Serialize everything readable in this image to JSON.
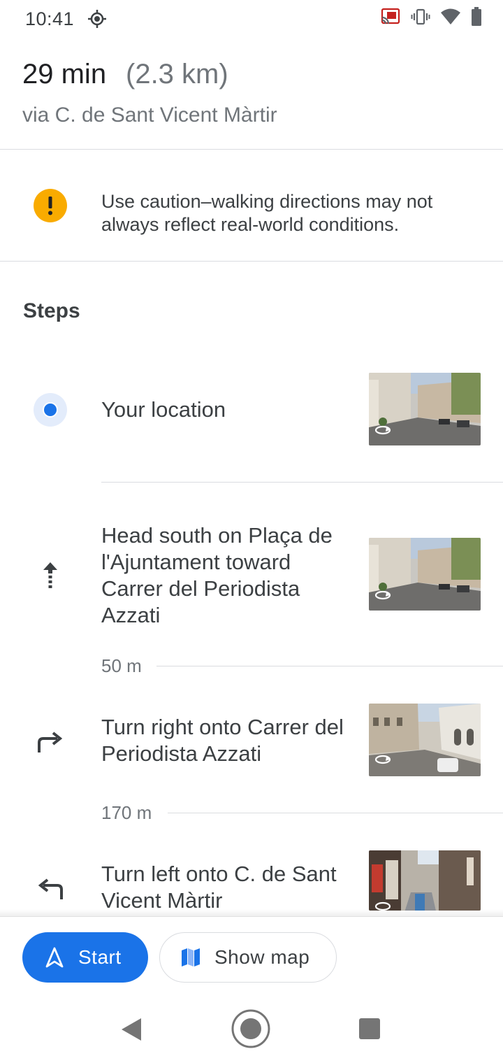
{
  "status_bar": {
    "time": "10:41",
    "icons": [
      "location-icon",
      "cast-icon",
      "vibrate-icon",
      "wifi-icon",
      "battery-icon"
    ]
  },
  "route": {
    "duration": "29 min",
    "distance": "(2.3 km)",
    "via": "via C. de Sant Vicent Màrtir"
  },
  "caution": {
    "icon": "warning-icon",
    "text": "Use caution–walking directions may not always reflect real-world conditions."
  },
  "steps_title": "Steps",
  "steps": [
    {
      "icon": "current-location-icon",
      "text": "Your location",
      "distance_after": ""
    },
    {
      "icon": "arrow-straight-icon",
      "text": "Head south on Plaça de l'Ajuntament toward Carrer del Periodista Azzati",
      "distance_after": "50 m"
    },
    {
      "icon": "turn-right-icon",
      "text": "Turn right onto Carrer del Periodista Azzati",
      "distance_after": "170 m"
    },
    {
      "icon": "turn-left-icon",
      "text": "Turn left onto C. de Sant Vicent Màrtir",
      "distance_after": ""
    }
  ],
  "actions": {
    "start_label": "Start",
    "show_map_label": "Show map"
  },
  "colors": {
    "accent": "#1a73e8",
    "warning": "#f9ab00",
    "text_primary": "#202124",
    "text_secondary": "#70757a",
    "divider": "#dadce0"
  }
}
